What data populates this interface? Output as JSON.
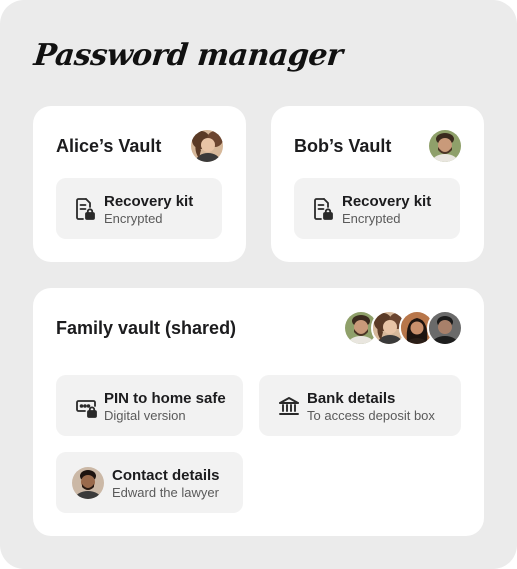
{
  "app": {
    "title": "Password manager"
  },
  "vaults": [
    {
      "title": "Alice’s Vault",
      "avatar": "woman-with-curly-hair-avatar",
      "items": [
        {
          "label": "Recovery kit",
          "sub": "Encrypted",
          "icon": "document-lock-icon"
        }
      ]
    },
    {
      "title": "Bob’s Vault",
      "avatar": "man-with-beard-avatar",
      "items": [
        {
          "label": "Recovery kit",
          "sub": "Encrypted",
          "icon": "document-lock-icon"
        }
      ]
    }
  ],
  "family": {
    "title": "Family vault (shared)",
    "members": [
      "man-with-beard-avatar",
      "woman-with-curly-hair-avatar",
      "woman-with-dark-hair-avatar",
      "man-with-short-hair-avatar"
    ],
    "items": [
      {
        "label": "PIN to home safe",
        "sub": "Digital version",
        "icon": "pin-lock-icon"
      },
      {
        "label": "Bank details",
        "sub": "To access deposit box",
        "icon": "bank-icon"
      },
      {
        "label": "Contact details",
        "sub": "Edward the lawyer",
        "icon": "edward-avatar"
      }
    ]
  },
  "colors": {
    "frame_bg": "#ebebeb",
    "card_bg": "#ffffff",
    "item_bg": "#f2f2f2",
    "text": "#1c1c1e",
    "subtext": "#5a5a5a"
  }
}
